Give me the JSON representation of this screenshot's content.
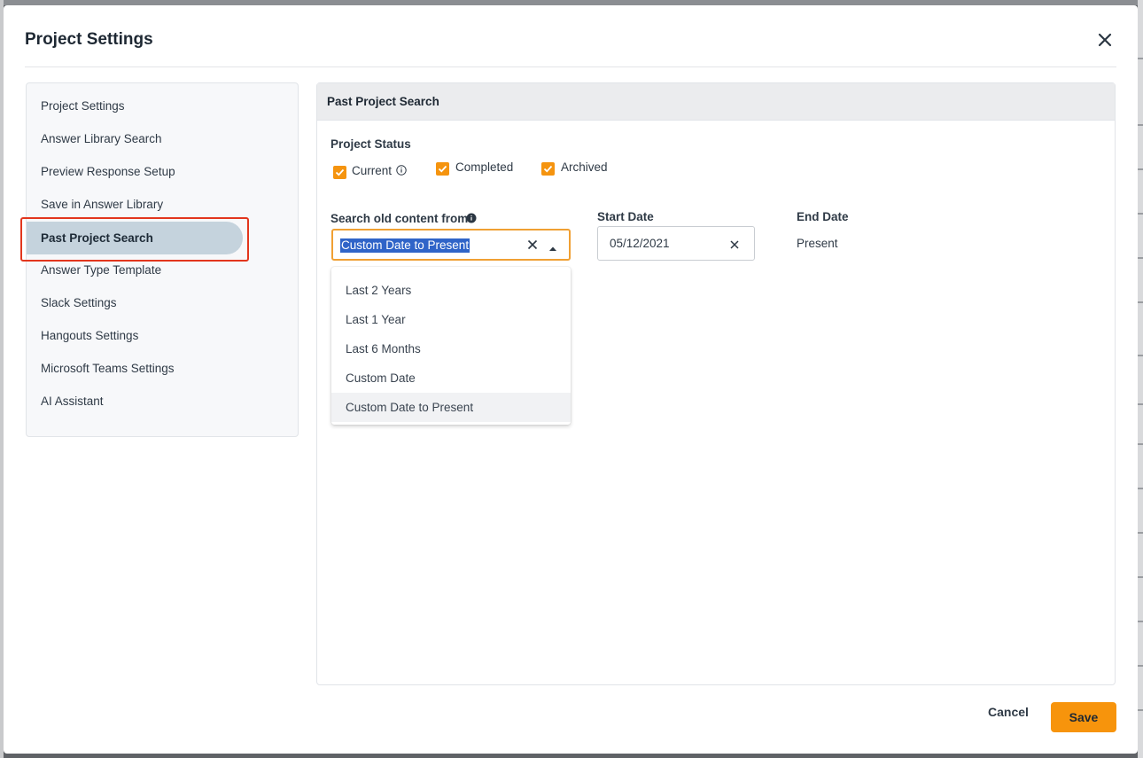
{
  "modal": {
    "title": "Project Settings",
    "close_icon": "close-icon"
  },
  "sidebar": {
    "items": [
      {
        "label": "Project Settings"
      },
      {
        "label": "Answer Library Search"
      },
      {
        "label": "Preview Response Setup"
      },
      {
        "label": "Save in Answer Library"
      },
      {
        "label": "Past Project Search",
        "active": true
      },
      {
        "label": "Answer Type Template"
      },
      {
        "label": "Slack Settings"
      },
      {
        "label": "Hangouts Settings"
      },
      {
        "label": "Microsoft Teams Settings"
      },
      {
        "label": "AI Assistant"
      }
    ]
  },
  "panel": {
    "title": "Past Project Search",
    "project_status": {
      "label": "Project Status",
      "options": [
        {
          "label": "Current",
          "checked": true
        },
        {
          "label": "Completed",
          "checked": true
        },
        {
          "label": "Archived",
          "checked": true
        }
      ]
    },
    "search_from": {
      "label": "Search old content from",
      "selected": "Custom Date to Present",
      "options": [
        "Last 2 Years",
        "Last 1 Year",
        "Last 6 Months",
        "Custom Date",
        "Custom Date to Present"
      ]
    },
    "start_date": {
      "label": "Start Date",
      "value": "05/12/2021"
    },
    "end_date": {
      "label": "End Date",
      "value": "Present"
    }
  },
  "footer": {
    "cancel_label": "Cancel",
    "save_label": "Save"
  },
  "colors": {
    "accent": "#f7940c",
    "active_nav": "#c5d3dd",
    "highlight_outline": "#e2361d",
    "selection": "#2f64c8"
  }
}
